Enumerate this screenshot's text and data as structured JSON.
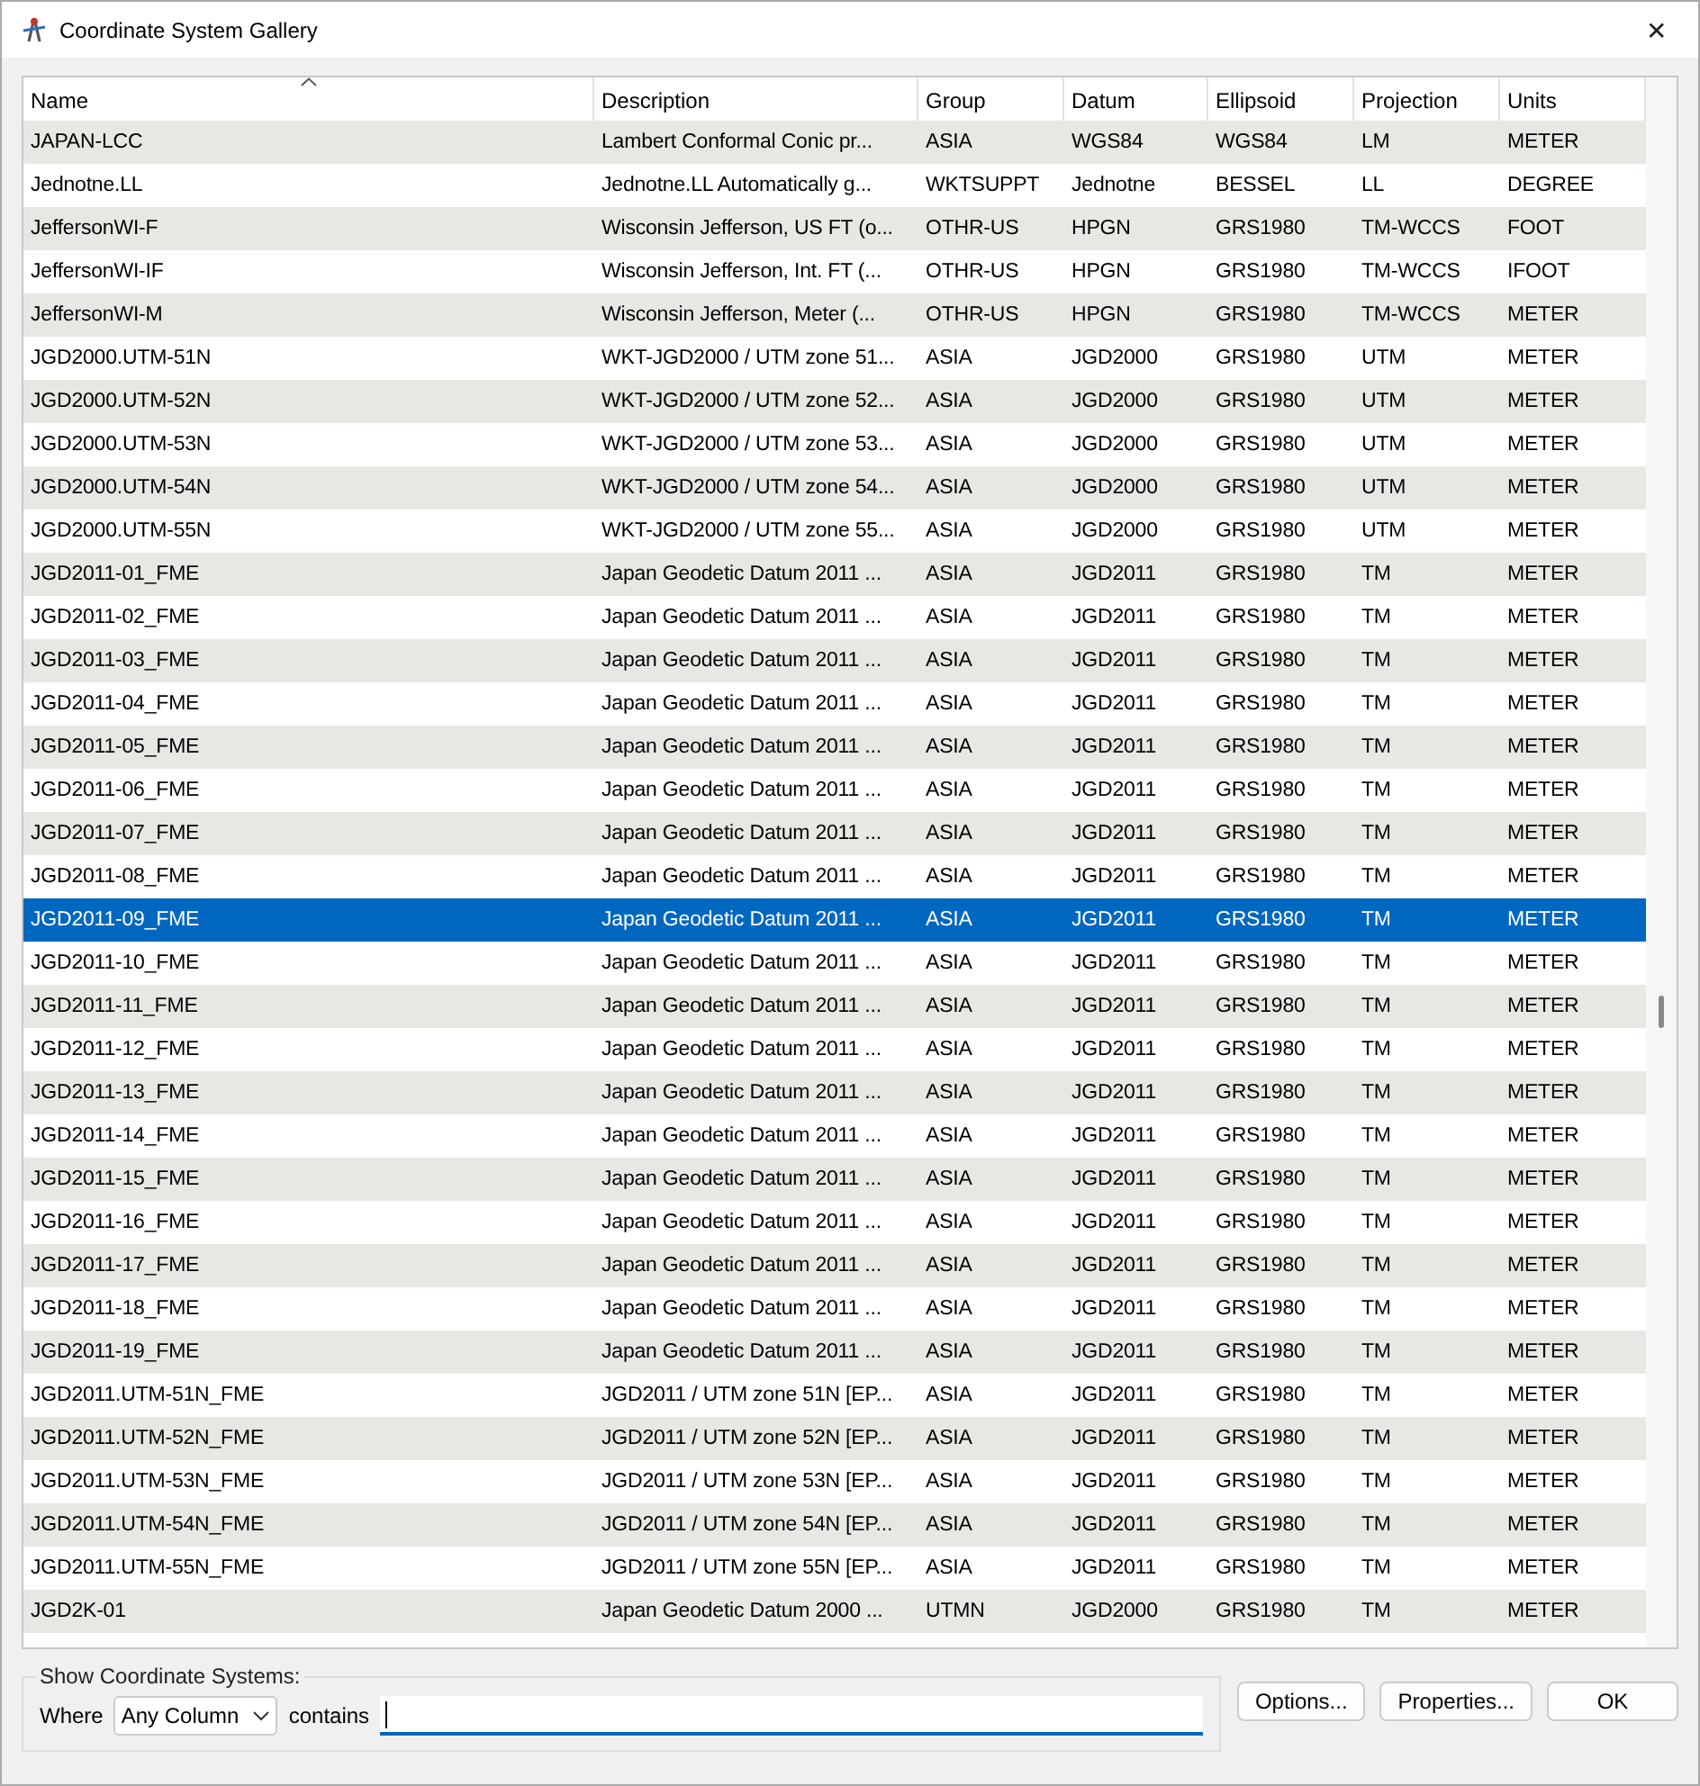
{
  "window": {
    "title": "Coordinate System Gallery",
    "close": "✕"
  },
  "table": {
    "columns": [
      {
        "label": "Name",
        "sorted": true
      },
      {
        "label": "Description",
        "sorted": false
      },
      {
        "label": "Group",
        "sorted": false
      },
      {
        "label": "Datum",
        "sorted": false
      },
      {
        "label": "Ellipsoid",
        "sorted": false
      },
      {
        "label": "Projection",
        "sorted": false
      },
      {
        "label": "Units",
        "sorted": false
      }
    ],
    "rows": [
      {
        "cells": [
          "JAPAN-LCC",
          "Lambert Conformal Conic pr...",
          "ASIA",
          "WGS84",
          "WGS84",
          "LM",
          "METER"
        ],
        "selected": false
      },
      {
        "cells": [
          "Jednotne.LL",
          "Jednotne.LL Automatically g...",
          "WKTSUPPT",
          "Jednotne",
          "BESSEL",
          "LL",
          "DEGREE"
        ],
        "selected": false
      },
      {
        "cells": [
          "JeffersonWI-F",
          "Wisconsin Jefferson, US FT (o...",
          "OTHR-US",
          "HPGN",
          "GRS1980",
          "TM-WCCS",
          "FOOT"
        ],
        "selected": false
      },
      {
        "cells": [
          "JeffersonWI-IF",
          "Wisconsin Jefferson, Int. FT (...",
          "OTHR-US",
          "HPGN",
          "GRS1980",
          "TM-WCCS",
          "IFOOT"
        ],
        "selected": false
      },
      {
        "cells": [
          "JeffersonWI-M",
          "Wisconsin Jefferson, Meter (...",
          "OTHR-US",
          "HPGN",
          "GRS1980",
          "TM-WCCS",
          "METER"
        ],
        "selected": false
      },
      {
        "cells": [
          "JGD2000.UTM-51N",
          "WKT-JGD2000 / UTM zone 51...",
          "ASIA",
          "JGD2000",
          "GRS1980",
          "UTM",
          "METER"
        ],
        "selected": false
      },
      {
        "cells": [
          "JGD2000.UTM-52N",
          "WKT-JGD2000 / UTM zone 52...",
          "ASIA",
          "JGD2000",
          "GRS1980",
          "UTM",
          "METER"
        ],
        "selected": false
      },
      {
        "cells": [
          "JGD2000.UTM-53N",
          "WKT-JGD2000 / UTM zone 53...",
          "ASIA",
          "JGD2000",
          "GRS1980",
          "UTM",
          "METER"
        ],
        "selected": false
      },
      {
        "cells": [
          "JGD2000.UTM-54N",
          "WKT-JGD2000 / UTM zone 54...",
          "ASIA",
          "JGD2000",
          "GRS1980",
          "UTM",
          "METER"
        ],
        "selected": false
      },
      {
        "cells": [
          "JGD2000.UTM-55N",
          "WKT-JGD2000 / UTM zone 55...",
          "ASIA",
          "JGD2000",
          "GRS1980",
          "UTM",
          "METER"
        ],
        "selected": false
      },
      {
        "cells": [
          "JGD2011-01_FME",
          "Japan Geodetic Datum 2011 ...",
          "ASIA",
          "JGD2011",
          "GRS1980",
          "TM",
          "METER"
        ],
        "selected": false
      },
      {
        "cells": [
          "JGD2011-02_FME",
          "Japan Geodetic Datum 2011 ...",
          "ASIA",
          "JGD2011",
          "GRS1980",
          "TM",
          "METER"
        ],
        "selected": false
      },
      {
        "cells": [
          "JGD2011-03_FME",
          "Japan Geodetic Datum 2011 ...",
          "ASIA",
          "JGD2011",
          "GRS1980",
          "TM",
          "METER"
        ],
        "selected": false
      },
      {
        "cells": [
          "JGD2011-04_FME",
          "Japan Geodetic Datum 2011 ...",
          "ASIA",
          "JGD2011",
          "GRS1980",
          "TM",
          "METER"
        ],
        "selected": false
      },
      {
        "cells": [
          "JGD2011-05_FME",
          "Japan Geodetic Datum 2011 ...",
          "ASIA",
          "JGD2011",
          "GRS1980",
          "TM",
          "METER"
        ],
        "selected": false
      },
      {
        "cells": [
          "JGD2011-06_FME",
          "Japan Geodetic Datum 2011 ...",
          "ASIA",
          "JGD2011",
          "GRS1980",
          "TM",
          "METER"
        ],
        "selected": false
      },
      {
        "cells": [
          "JGD2011-07_FME",
          "Japan Geodetic Datum 2011 ...",
          "ASIA",
          "JGD2011",
          "GRS1980",
          "TM",
          "METER"
        ],
        "selected": false
      },
      {
        "cells": [
          "JGD2011-08_FME",
          "Japan Geodetic Datum 2011 ...",
          "ASIA",
          "JGD2011",
          "GRS1980",
          "TM",
          "METER"
        ],
        "selected": false
      },
      {
        "cells": [
          "JGD2011-09_FME",
          "Japan Geodetic Datum 2011 ...",
          "ASIA",
          "JGD2011",
          "GRS1980",
          "TM",
          "METER"
        ],
        "selected": true
      },
      {
        "cells": [
          "JGD2011-10_FME",
          "Japan Geodetic Datum 2011 ...",
          "ASIA",
          "JGD2011",
          "GRS1980",
          "TM",
          "METER"
        ],
        "selected": false
      },
      {
        "cells": [
          "JGD2011-11_FME",
          "Japan Geodetic Datum 2011 ...",
          "ASIA",
          "JGD2011",
          "GRS1980",
          "TM",
          "METER"
        ],
        "selected": false
      },
      {
        "cells": [
          "JGD2011-12_FME",
          "Japan Geodetic Datum 2011 ...",
          "ASIA",
          "JGD2011",
          "GRS1980",
          "TM",
          "METER"
        ],
        "selected": false
      },
      {
        "cells": [
          "JGD2011-13_FME",
          "Japan Geodetic Datum 2011 ...",
          "ASIA",
          "JGD2011",
          "GRS1980",
          "TM",
          "METER"
        ],
        "selected": false
      },
      {
        "cells": [
          "JGD2011-14_FME",
          "Japan Geodetic Datum 2011 ...",
          "ASIA",
          "JGD2011",
          "GRS1980",
          "TM",
          "METER"
        ],
        "selected": false
      },
      {
        "cells": [
          "JGD2011-15_FME",
          "Japan Geodetic Datum 2011 ...",
          "ASIA",
          "JGD2011",
          "GRS1980",
          "TM",
          "METER"
        ],
        "selected": false
      },
      {
        "cells": [
          "JGD2011-16_FME",
          "Japan Geodetic Datum 2011 ...",
          "ASIA",
          "JGD2011",
          "GRS1980",
          "TM",
          "METER"
        ],
        "selected": false
      },
      {
        "cells": [
          "JGD2011-17_FME",
          "Japan Geodetic Datum 2011 ...",
          "ASIA",
          "JGD2011",
          "GRS1980",
          "TM",
          "METER"
        ],
        "selected": false
      },
      {
        "cells": [
          "JGD2011-18_FME",
          "Japan Geodetic Datum 2011 ...",
          "ASIA",
          "JGD2011",
          "GRS1980",
          "TM",
          "METER"
        ],
        "selected": false
      },
      {
        "cells": [
          "JGD2011-19_FME",
          "Japan Geodetic Datum 2011 ...",
          "ASIA",
          "JGD2011",
          "GRS1980",
          "TM",
          "METER"
        ],
        "selected": false
      },
      {
        "cells": [
          "JGD2011.UTM-51N_FME",
          "JGD2011 / UTM zone 51N [EP...",
          "ASIA",
          "JGD2011",
          "GRS1980",
          "TM",
          "METER"
        ],
        "selected": false
      },
      {
        "cells": [
          "JGD2011.UTM-52N_FME",
          "JGD2011 / UTM zone 52N [EP...",
          "ASIA",
          "JGD2011",
          "GRS1980",
          "TM",
          "METER"
        ],
        "selected": false
      },
      {
        "cells": [
          "JGD2011.UTM-53N_FME",
          "JGD2011 / UTM zone 53N [EP...",
          "ASIA",
          "JGD2011",
          "GRS1980",
          "TM",
          "METER"
        ],
        "selected": false
      },
      {
        "cells": [
          "JGD2011.UTM-54N_FME",
          "JGD2011 / UTM zone 54N [EP...",
          "ASIA",
          "JGD2011",
          "GRS1980",
          "TM",
          "METER"
        ],
        "selected": false
      },
      {
        "cells": [
          "JGD2011.UTM-55N_FME",
          "JGD2011 / UTM zone 55N [EP...",
          "ASIA",
          "JGD2011",
          "GRS1980",
          "TM",
          "METER"
        ],
        "selected": false
      },
      {
        "cells": [
          "JGD2K-01",
          "Japan Geodetic Datum 2000 ...",
          "UTMN",
          "JGD2000",
          "GRS1980",
          "TM",
          "METER"
        ],
        "selected": false
      }
    ]
  },
  "filter": {
    "legend": "Show Coordinate Systems:",
    "where_label": "Where",
    "column_select": "Any Column",
    "contains_label": "contains",
    "search_field": {
      "focused": true
    }
  },
  "buttons": [
    "Options...",
    "Properties...",
    "OK"
  ]
}
